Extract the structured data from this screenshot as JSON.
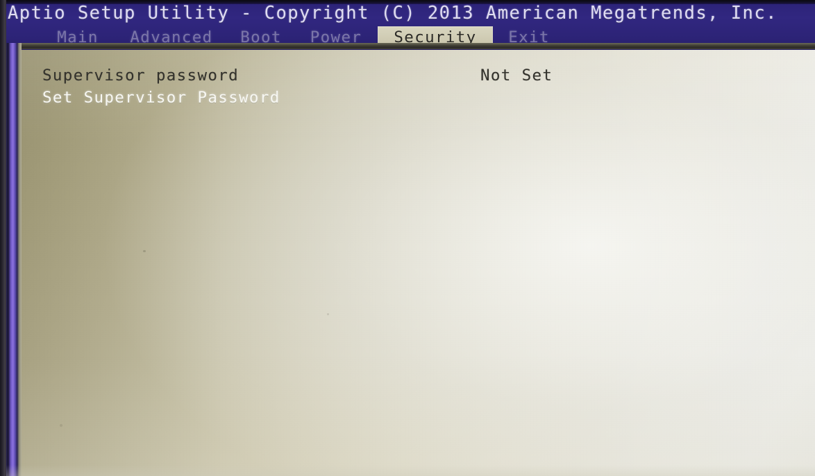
{
  "header": {
    "title": "Aptio Setup Utility - Copyright (C) 2013 American Megatrends, Inc.",
    "bar_color": "#2e2480",
    "title_color": "#dfdcf2"
  },
  "tabs": {
    "active_index": 4,
    "active_bg": "#d4d0b8",
    "active_fg": "#2b2a26",
    "inactive_fg": "#8d88b4",
    "items": [
      {
        "label": "Main",
        "active": false
      },
      {
        "label": "Advanced",
        "active": false
      },
      {
        "label": "Boot",
        "active": false
      },
      {
        "label": "Power",
        "active": false
      },
      {
        "label": "Security",
        "active": true
      },
      {
        "label": "Exit",
        "active": false
      }
    ]
  },
  "main": {
    "panel_bg_light": "#eeeeea",
    "panel_bg_dark": "#9c9673",
    "settings": [
      {
        "label": "Supervisor password",
        "value": "Not Set",
        "selected": false,
        "label_style": "dark",
        "value_style": "dark"
      },
      {
        "label": "Set Supervisor Password",
        "value": "",
        "selected": true,
        "label_style": "light",
        "value_style": "light"
      }
    ]
  }
}
